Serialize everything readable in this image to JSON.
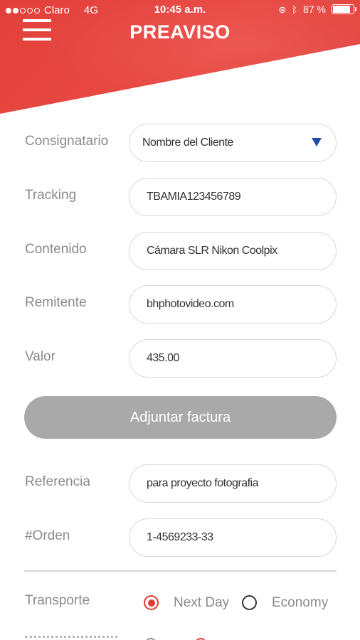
{
  "status_bar": {
    "carrier": "Claro",
    "network": "4G",
    "time": "10:45 a.m.",
    "battery": "87 %",
    "battery_level": 0.87
  },
  "header": {
    "title": "PREAVISO",
    "menu_icon": "hamburger-menu-icon"
  },
  "colors": {
    "brand_red": "#e2403b",
    "radio_selected": "#e33b36",
    "dropdown_caret": "#1f4ea8",
    "button_gray": "#a9a9a9"
  },
  "form": {
    "consignatario": {
      "label": "Consignatario",
      "value": "Nombre del Cliente"
    },
    "tracking": {
      "label": "Tracking",
      "value": "TBAMIA123456789"
    },
    "contenido": {
      "label": "Contenido",
      "value": "Cámara SLR Nikon Coolpix"
    },
    "remitente": {
      "label": "Remitente",
      "value": "bhphotovideo.com"
    },
    "valor": {
      "label": "Valor",
      "value": "435.00"
    },
    "attach_button": "Adjuntar factura",
    "referencia": {
      "label": "Referencia",
      "value": "para proyecto fotografia"
    },
    "orden": {
      "label": "#Orden",
      "value": "1-4569233-33"
    },
    "transporte": {
      "label": "Transporte",
      "options": [
        {
          "label": "Next Day",
          "selected": true
        },
        {
          "label": "Economy",
          "selected": false
        }
      ]
    }
  }
}
